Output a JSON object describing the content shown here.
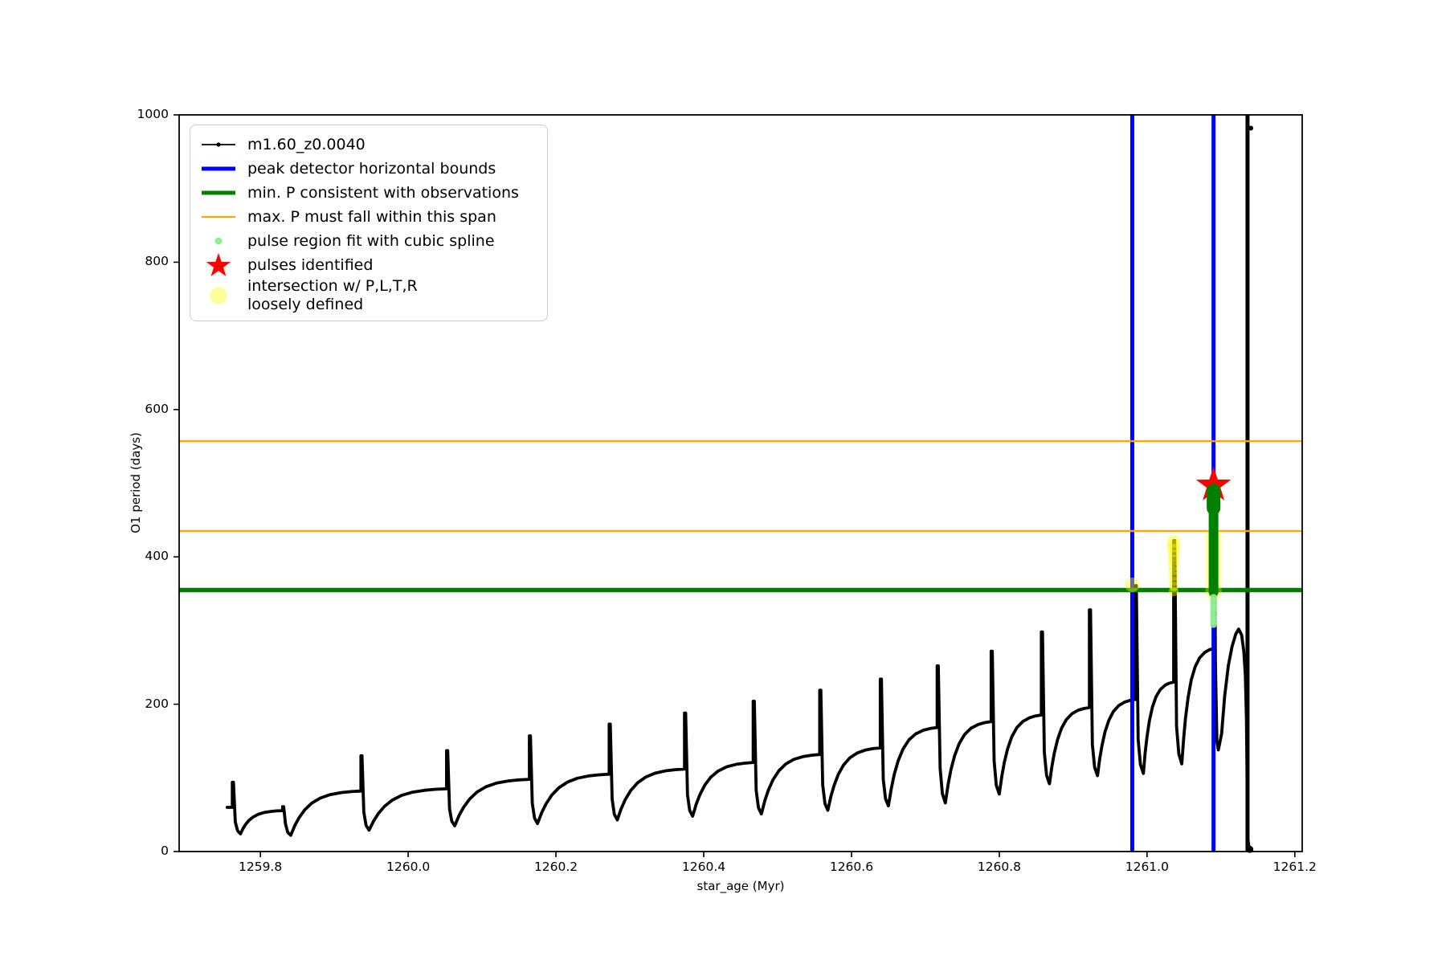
{
  "axes": {
    "xlabel": "star_age (Myr)",
    "ylabel": "O1 period (days)",
    "xlim": [
      1259.69,
      1261.21
    ],
    "ylim": [
      0,
      1000
    ],
    "xticks": [
      1259.8,
      1260.0,
      1260.2,
      1260.4,
      1260.6,
      1260.8,
      1261.0,
      1261.2
    ],
    "xtick_labels": [
      "1259.8",
      "1260.0",
      "1260.2",
      "1260.4",
      "1260.6",
      "1260.8",
      "1261.0",
      "1261.2"
    ],
    "yticks": [
      0,
      200,
      400,
      600,
      800,
      1000
    ],
    "ytick_labels": [
      "0",
      "200",
      "400",
      "600",
      "800",
      "1000"
    ]
  },
  "legend": {
    "items": [
      {
        "label": "m1.60_z0.0040",
        "marker": "line-dot",
        "color": "#000000"
      },
      {
        "label": "peak detector horizontal bounds",
        "marker": "thick-line",
        "color": "#0000ff"
      },
      {
        "label": "min. P consistent with observations",
        "marker": "thick-line",
        "color": "#008000"
      },
      {
        "label": "max. P must fall within this span",
        "marker": "thin-line",
        "color": "#ffa500"
      },
      {
        "label": "pulse region fit with cubic spline",
        "marker": "dot-small",
        "color": "#90ee90"
      },
      {
        "label": "pulses identified",
        "marker": "star",
        "color": "#ff0000"
      },
      {
        "label": "intersection w/ P,L,T,R\nloosely defined",
        "marker": "dot-big",
        "color": "#ffff00"
      }
    ]
  },
  "colors": {
    "series": "#000000",
    "peak_bounds": "#0000ff",
    "min_P": "#008000",
    "max_P": "#ffa500",
    "spline_dots": "#90ee90",
    "pulse_star": "#ff0000",
    "intersection": "#ffff00"
  },
  "chart_data": {
    "type": "line",
    "title": "",
    "xlabel": "star_age (Myr)",
    "ylabel": "O1 period (days)",
    "xlim": [
      1259.69,
      1261.21
    ],
    "ylim": [
      0,
      1000
    ],
    "series_label": "m1.60_z0.0040",
    "peak_detector_bounds_x": [
      1260.98,
      1261.09
    ],
    "min_P_consistent": 355,
    "max_P_span": [
      435,
      557
    ],
    "event_line_x": 1261.136,
    "curve_start": {
      "x": 1259.755,
      "y": 60
    },
    "cycles": [
      {
        "spike_x": 1259.762,
        "spike_top": 94,
        "dip_min": 24,
        "plateau": 56
      },
      {
        "spike_x": 1259.83,
        "spike_top": 61,
        "dip_min": 22,
        "plateau": 83
      },
      {
        "spike_x": 1259.936,
        "spike_top": 130,
        "dip_min": 29,
        "plateau": 86
      },
      {
        "spike_x": 1260.052,
        "spike_top": 137,
        "dip_min": 35,
        "plateau": 99
      },
      {
        "spike_x": 1260.164,
        "spike_top": 157,
        "dip_min": 38,
        "plateau": 106
      },
      {
        "spike_x": 1260.272,
        "spike_top": 173,
        "dip_min": 43,
        "plateau": 113
      },
      {
        "spike_x": 1260.374,
        "spike_top": 188,
        "dip_min": 48,
        "plateau": 122
      },
      {
        "spike_x": 1260.467,
        "spike_top": 204,
        "dip_min": 51,
        "plateau": 133
      },
      {
        "spike_x": 1260.557,
        "spike_top": 219,
        "dip_min": 56,
        "plateau": 142
      },
      {
        "spike_x": 1260.639,
        "spike_top": 234,
        "dip_min": 62,
        "plateau": 170
      },
      {
        "spike_x": 1260.716,
        "spike_top": 252,
        "dip_min": 66,
        "plateau": 178
      },
      {
        "spike_x": 1260.789,
        "spike_top": 272,
        "dip_min": 78,
        "plateau": 187
      },
      {
        "spike_x": 1260.857,
        "spike_top": 298,
        "dip_min": 92,
        "plateau": 197
      },
      {
        "spike_x": 1260.922,
        "spike_top": 328,
        "dip_min": 103,
        "plateau": 208
      },
      {
        "spike_x": 1260.984,
        "spike_top": 361,
        "dip_min": 106,
        "plateau": 232
      },
      {
        "spike_x": 1261.036,
        "spike_top": 422,
        "dip_min": 119,
        "plateau": 278
      },
      {
        "spike_x": 1261.09,
        "spike_top": 490,
        "dip_min": 138,
        "plateau": null
      }
    ],
    "tail": [
      [
        1261.0925,
        260
      ],
      [
        1261.0945,
        150
      ],
      [
        1261.0965,
        138
      ],
      [
        1261.101,
        160
      ],
      [
        1261.105,
        210
      ],
      [
        1261.11,
        252
      ],
      [
        1261.115,
        278
      ],
      [
        1261.12,
        295
      ],
      [
        1261.124,
        302
      ],
      [
        1261.128,
        294
      ],
      [
        1261.131,
        272
      ],
      [
        1261.133,
        240
      ],
      [
        1261.1345,
        180
      ],
      [
        1261.1355,
        90
      ],
      [
        1261.136,
        20
      ],
      [
        1261.1385,
        3
      ]
    ],
    "end_dot": {
      "x": 1261.139,
      "y": 3
    },
    "event_top_dot": {
      "x": 1261.1405,
      "y": 982
    },
    "pulse_star": {
      "x": 1261.09,
      "y": 497
    },
    "cluster_green": {
      "x": 1261.09,
      "y_min": 352,
      "y_max": 490
    },
    "spline_fit_dots": {
      "x": 1261.09,
      "y": [
        308,
        312,
        316,
        320,
        325,
        329,
        333,
        337,
        341,
        345
      ]
    },
    "intersection_dots": [
      {
        "x": 1260.98,
        "y": 362,
        "r": 9
      },
      {
        "x": 1261.036,
        "y": 353,
        "r": 6
      },
      {
        "x": 1261.036,
        "y": 360,
        "r": 6
      },
      {
        "x": 1261.036,
        "y": 367,
        "r": 6
      },
      {
        "x": 1261.036,
        "y": 374,
        "r": 6
      },
      {
        "x": 1261.036,
        "y": 381,
        "r": 6
      },
      {
        "x": 1261.036,
        "y": 388,
        "r": 7
      },
      {
        "x": 1261.036,
        "y": 395,
        "r": 7
      },
      {
        "x": 1261.036,
        "y": 402,
        "r": 7
      },
      {
        "x": 1261.036,
        "y": 409,
        "r": 8
      },
      {
        "x": 1261.036,
        "y": 415,
        "r": 8
      },
      {
        "x": 1261.036,
        "y": 421,
        "r": 8
      }
    ],
    "intersection_halo": {
      "x": 1261.09,
      "y_min": 352,
      "y_max": 428
    }
  }
}
